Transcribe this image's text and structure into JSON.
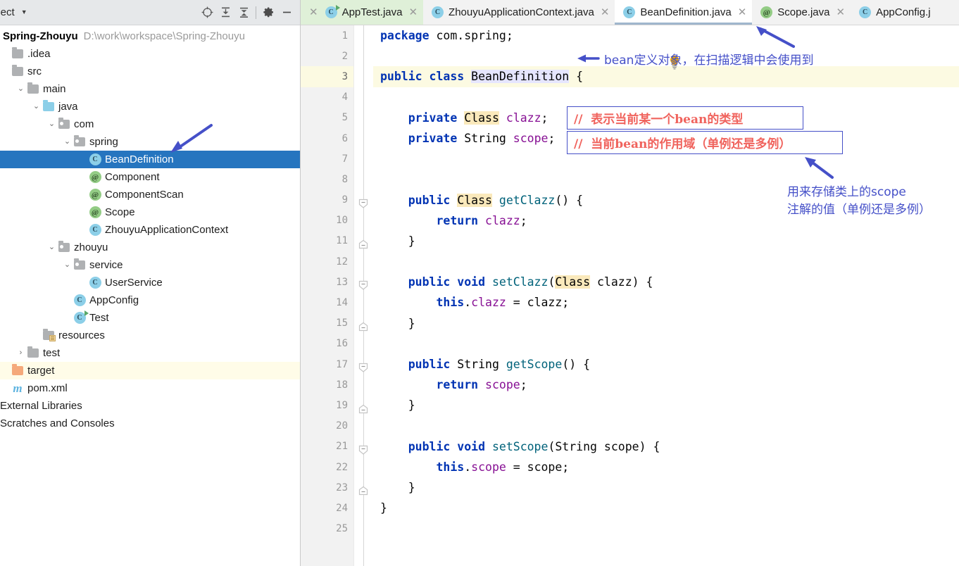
{
  "project_panel": {
    "title": "roject",
    "caret_icon": "chevron-down-icon",
    "toolbar_buttons": [
      {
        "name": "locate-icon",
        "label": "Select Opened File"
      },
      {
        "name": "expand-all-icon",
        "label": "Expand All"
      },
      {
        "name": "collapse-all-icon",
        "label": "Collapse All"
      },
      {
        "name": "gear-icon",
        "label": "Settings"
      },
      {
        "name": "minimize-icon",
        "label": "Hide"
      }
    ],
    "project_name": "Spring-Zhouyu",
    "project_path": "D:\\work\\workspace\\Spring-Zhouyu",
    "tree": [
      {
        "label": ".idea",
        "icon": "folder-icon",
        "indent": 0,
        "arrow": "",
        "state": "normal"
      },
      {
        "label": "src",
        "icon": "folder-icon",
        "indent": 0,
        "arrow": "",
        "state": "normal"
      },
      {
        "label": "main",
        "icon": "folder-icon",
        "indent": 1,
        "arrow": "v",
        "state": "normal"
      },
      {
        "label": "java",
        "icon": "source-folder-icon",
        "indent": 2,
        "arrow": "v",
        "state": "normal"
      },
      {
        "label": "com",
        "icon": "package-folder-icon",
        "indent": 3,
        "arrow": "v",
        "state": "normal"
      },
      {
        "label": "spring",
        "icon": "package-folder-icon",
        "indent": 4,
        "arrow": "v",
        "state": "normal"
      },
      {
        "label": "BeanDefinition",
        "icon": "java-class-icon",
        "indent": 5,
        "arrow": "",
        "state": "selected"
      },
      {
        "label": "Component",
        "icon": "java-annotation-icon",
        "indent": 5,
        "arrow": "",
        "state": "normal"
      },
      {
        "label": "ComponentScan",
        "icon": "java-annotation-icon",
        "indent": 5,
        "arrow": "",
        "state": "normal"
      },
      {
        "label": "Scope",
        "icon": "java-annotation-icon",
        "indent": 5,
        "arrow": "",
        "state": "normal"
      },
      {
        "label": "ZhouyuApplicationContext",
        "icon": "java-class-icon",
        "indent": 5,
        "arrow": "",
        "state": "normal"
      },
      {
        "label": "zhouyu",
        "icon": "package-folder-icon",
        "indent": 3,
        "arrow": "v",
        "state": "normal"
      },
      {
        "label": "service",
        "icon": "package-folder-icon",
        "indent": 4,
        "arrow": "v",
        "state": "normal"
      },
      {
        "label": "UserService",
        "icon": "java-class-icon",
        "indent": 5,
        "arrow": "",
        "state": "normal"
      },
      {
        "label": "AppConfig",
        "icon": "java-class-icon",
        "indent": 4,
        "arrow": "",
        "state": "normal"
      },
      {
        "label": "Test",
        "icon": "java-runnable-class-icon",
        "indent": 4,
        "arrow": "",
        "state": "normal"
      },
      {
        "label": "resources",
        "icon": "resources-folder-icon",
        "indent": 2,
        "arrow": "",
        "state": "normal"
      },
      {
        "label": "test",
        "icon": "folder-icon",
        "indent": 1,
        "arrow": ">",
        "state": "normal"
      },
      {
        "label": "target",
        "icon": "excluded-folder-icon",
        "indent": 0,
        "arrow": "",
        "state": "excluded"
      },
      {
        "label": "pom.xml",
        "icon": "maven-icon",
        "indent": 0,
        "arrow": "",
        "state": "normal"
      },
      {
        "label": "External Libraries",
        "icon": "",
        "indent": -1,
        "arrow": "",
        "state": "normal"
      },
      {
        "label": "Scratches and Consoles",
        "icon": "",
        "indent": -1,
        "arrow": "",
        "state": "normal"
      }
    ]
  },
  "editor": {
    "tabs": [
      {
        "label": "AppTest.java",
        "icon": "java-runnable-class-icon",
        "state": "run",
        "close_icon": "close-icon"
      },
      {
        "label": "ZhouyuApplicationContext.java",
        "icon": "java-class-icon",
        "state": "normal",
        "close_icon": "close-icon"
      },
      {
        "label": "BeanDefinition.java",
        "icon": "java-class-icon",
        "state": "active",
        "close_icon": "close-icon"
      },
      {
        "label": "Scope.java",
        "icon": "java-annotation-icon",
        "state": "normal",
        "close_icon": "close-icon"
      },
      {
        "label": "AppConfig.j",
        "icon": "java-class-icon",
        "state": "normal",
        "close_icon": ""
      }
    ],
    "bulb_icon": "intention-bulb-icon",
    "line_numbers": [
      1,
      2,
      3,
      4,
      5,
      6,
      7,
      8,
      9,
      10,
      11,
      12,
      13,
      14,
      15,
      16,
      17,
      18,
      19,
      20,
      21,
      22,
      23,
      24,
      25
    ],
    "current_line": 3,
    "code_lines": [
      {
        "n": 1,
        "tokens": [
          {
            "t": "package ",
            "c": "k"
          },
          {
            "t": "com.spring;",
            "c": "pln"
          }
        ]
      },
      {
        "n": 2,
        "tokens": []
      },
      {
        "n": 3,
        "tokens": [
          {
            "t": "public ",
            "c": "k"
          },
          {
            "t": "class ",
            "c": "k"
          },
          {
            "t": "BeanDefinition",
            "c": "caret-box"
          },
          {
            "t": " {",
            "c": "pln"
          }
        ]
      },
      {
        "n": 4,
        "tokens": []
      },
      {
        "n": 5,
        "tokens": [
          {
            "t": "    private ",
            "c": "k"
          },
          {
            "t": "Class",
            "c": "ident-hl"
          },
          {
            "t": " ",
            "c": "pln"
          },
          {
            "t": "clazz",
            "c": "fld"
          },
          {
            "t": ";",
            "c": "pln"
          }
        ]
      },
      {
        "n": 6,
        "tokens": [
          {
            "t": "    private ",
            "c": "k"
          },
          {
            "t": "String ",
            "c": "typ"
          },
          {
            "t": "scope",
            "c": "fld"
          },
          {
            "t": ";",
            "c": "pln"
          }
        ]
      },
      {
        "n": 7,
        "tokens": []
      },
      {
        "n": 8,
        "tokens": []
      },
      {
        "n": 9,
        "tokens": [
          {
            "t": "    public ",
            "c": "k"
          },
          {
            "t": "Class",
            "c": "ident-hl"
          },
          {
            "t": " ",
            "c": "pln"
          },
          {
            "t": "getClazz",
            "c": "mth"
          },
          {
            "t": "() {",
            "c": "pln"
          }
        ]
      },
      {
        "n": 10,
        "tokens": [
          {
            "t": "        return ",
            "c": "k"
          },
          {
            "t": "clazz",
            "c": "fld"
          },
          {
            "t": ";",
            "c": "pln"
          }
        ]
      },
      {
        "n": 11,
        "tokens": [
          {
            "t": "    }",
            "c": "pln"
          }
        ]
      },
      {
        "n": 12,
        "tokens": []
      },
      {
        "n": 13,
        "tokens": [
          {
            "t": "    public void ",
            "c": "k"
          },
          {
            "t": "setClazz",
            "c": "mth"
          },
          {
            "t": "(",
            "c": "pln"
          },
          {
            "t": "Class",
            "c": "ident-hl"
          },
          {
            "t": " clazz) {",
            "c": "pln"
          }
        ]
      },
      {
        "n": 14,
        "tokens": [
          {
            "t": "        this",
            "c": "k"
          },
          {
            "t": ".",
            "c": "pln"
          },
          {
            "t": "clazz",
            "c": "fld"
          },
          {
            "t": " = clazz;",
            "c": "pln"
          }
        ]
      },
      {
        "n": 15,
        "tokens": [
          {
            "t": "    }",
            "c": "pln"
          }
        ]
      },
      {
        "n": 16,
        "tokens": []
      },
      {
        "n": 17,
        "tokens": [
          {
            "t": "    public ",
            "c": "k"
          },
          {
            "t": "String ",
            "c": "typ"
          },
          {
            "t": "getScope",
            "c": "mth"
          },
          {
            "t": "() {",
            "c": "pln"
          }
        ]
      },
      {
        "n": 18,
        "tokens": [
          {
            "t": "        return ",
            "c": "k"
          },
          {
            "t": "scope",
            "c": "fld"
          },
          {
            "t": ";",
            "c": "pln"
          }
        ]
      },
      {
        "n": 19,
        "tokens": [
          {
            "t": "    }",
            "c": "pln"
          }
        ]
      },
      {
        "n": 20,
        "tokens": []
      },
      {
        "n": 21,
        "tokens": [
          {
            "t": "    public void ",
            "c": "k"
          },
          {
            "t": "setScope",
            "c": "mth"
          },
          {
            "t": "(String scope) {",
            "c": "pln"
          }
        ]
      },
      {
        "n": 22,
        "tokens": [
          {
            "t": "        this",
            "c": "k"
          },
          {
            "t": ".",
            "c": "pln"
          },
          {
            "t": "scope",
            "c": "fld"
          },
          {
            "t": " = scope;",
            "c": "pln"
          }
        ]
      },
      {
        "n": 23,
        "tokens": [
          {
            "t": "    }",
            "c": "pln"
          }
        ]
      },
      {
        "n": 24,
        "tokens": [
          {
            "t": "}",
            "c": "pln"
          }
        ]
      },
      {
        "n": 25,
        "tokens": []
      }
    ],
    "fold_markers": [
      {
        "line": 9,
        "type": "open"
      },
      {
        "line": 11,
        "type": "close"
      },
      {
        "line": 13,
        "type": "open"
      },
      {
        "line": 15,
        "type": "close"
      },
      {
        "line": 17,
        "type": "open"
      },
      {
        "line": 19,
        "type": "close"
      },
      {
        "line": 21,
        "type": "open"
      },
      {
        "line": 23,
        "type": "close"
      }
    ]
  },
  "annotations": {
    "accent_blue": "#4550c8",
    "comment_red": "#f0635d",
    "items": [
      {
        "id": "tab-arrow",
        "kind": "arrow",
        "name": "annotation-arrow-to-tab"
      },
      {
        "id": "tree-arrow",
        "kind": "arrow",
        "name": "annotation-arrow-to-tree-node"
      },
      {
        "id": "scope-arrow",
        "kind": "arrow",
        "name": "annotation-arrow-to-scope-comment"
      },
      {
        "id": "bean-note",
        "kind": "text",
        "name": "annotation-bean-definition-note",
        "text": "bean定义对象，在扫描逻辑中会使用到"
      },
      {
        "id": "clazz-note",
        "kind": "box",
        "name": "annotation-clazz-comment",
        "text": "//  表示当前某一个bean的类型"
      },
      {
        "id": "scope-note",
        "kind": "box",
        "name": "annotation-scope-comment",
        "text": "//  当前bean的作用域（单例还是多例）"
      },
      {
        "id": "scope-desc-1",
        "kind": "text",
        "name": "annotation-scope-usage-line1",
        "text": "用来存储类上的scope"
      },
      {
        "id": "scope-desc-2",
        "kind": "text",
        "name": "annotation-scope-usage-line2",
        "text": "注解的值（单例还是多例）"
      }
    ]
  }
}
